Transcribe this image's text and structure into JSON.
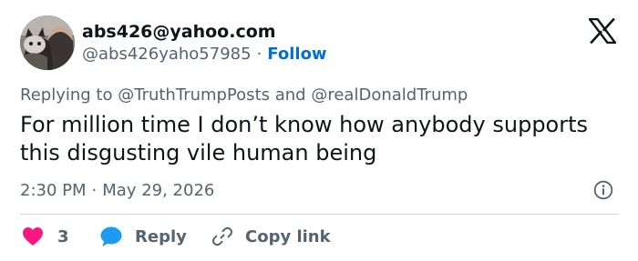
{
  "author": {
    "display_name": "abs426@yahoo.com",
    "handle": "@abs426yaho57985",
    "separator": "·",
    "follow_label": "Follow"
  },
  "reply_context": {
    "prefix": "Replying to",
    "mention_1": "@TruthTrumpPosts",
    "conjunction": "and",
    "mention_2": "@realDonaldTrump"
  },
  "tweet": {
    "text": "For million time I don’t know how anybody supports this disgusting vile human being",
    "time": "2:30 PM",
    "separator": "·",
    "date": "May 29, 2026"
  },
  "actions": {
    "like_count": "3",
    "reply_label": "Reply",
    "copy_link_label": "Copy link"
  },
  "colors": {
    "accent": "#006fd6",
    "like": "#f91880",
    "reply_icon": "#1d9bf0",
    "muted_text": "#536471"
  },
  "icons": [
    "x-logo-icon",
    "info-icon",
    "heart-icon",
    "speech-bubble-icon",
    "link-icon"
  ]
}
